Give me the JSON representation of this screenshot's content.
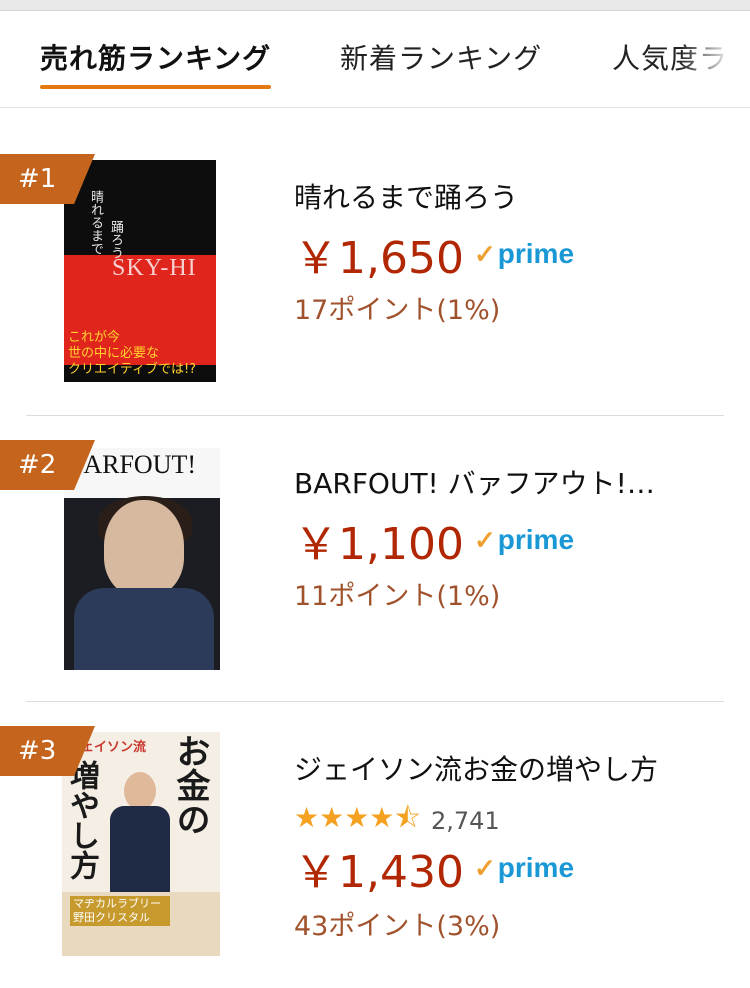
{
  "tabs": [
    {
      "label": "売れ筋ランキング",
      "active": true
    },
    {
      "label": "新着ランキング",
      "active": false
    },
    {
      "label": "人気度ランキング",
      "active": false
    }
  ],
  "accent_color": "#e47911",
  "rank_badge_color": "#c5641c",
  "price_color": "#b12704",
  "products": [
    {
      "rank": "#1",
      "title": "晴れるまで踊ろう",
      "price": "￥1,650",
      "prime": "prime",
      "points": "17ポイント(1%)",
      "cover": {
        "sky": "SKY-HI",
        "text1": "晴れるまで",
        "text2": "踊ろう",
        "foot1": "これが今",
        "foot2": "世の中に必要な",
        "foot3": "クリエイティブでは!?"
      }
    },
    {
      "rank": "#2",
      "title": "BARFOUT! バァフアウト!…",
      "price": "￥1,100",
      "prime": "prime",
      "points": "11ポイント(1%)",
      "cover": {
        "mast": "BARFOUT!"
      }
    },
    {
      "rank": "#3",
      "title": "ジェイソン流お金の増やし方",
      "rating": 4.5,
      "stars": "★★★★⯪",
      "review_count": "2,741",
      "price": "￥1,430",
      "prime": "prime",
      "points": "43ポイント(3%)",
      "cover": {
        "top": "ジェイソン流",
        "main1": "お金の",
        "main2": "増やし方",
        "tag": "マヂカルラブリー 野田クリスタル"
      }
    }
  ]
}
